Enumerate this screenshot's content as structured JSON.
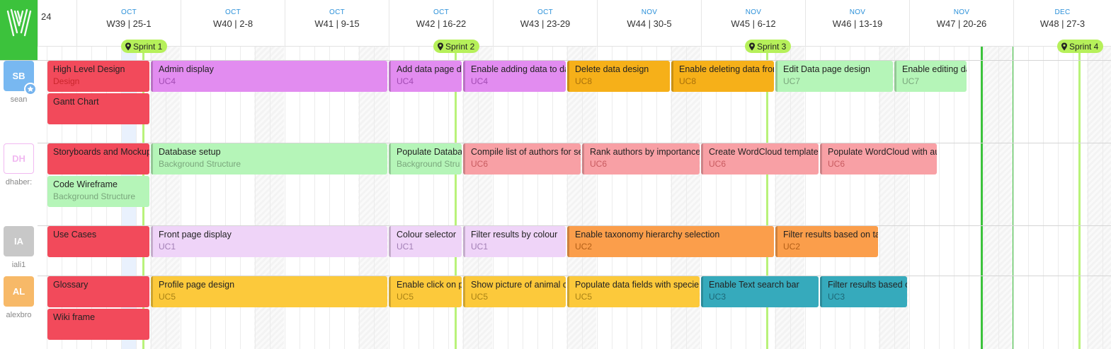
{
  "app": {
    "logo_letter": "W"
  },
  "colors": {
    "red": "#f24a5b",
    "violet": "#e28cf0",
    "green": "#b5f5b8",
    "amber": "#f6b019",
    "pink": "#f8a0a5",
    "lilac": "#efd4f8",
    "orange": "#fb9e4b",
    "yellow": "#fcc93b",
    "teal": "#36aabc",
    "sprint": "#b6f05a"
  },
  "timeline": {
    "first_partial": "24",
    "weeks": [
      {
        "month": "OCT",
        "label": "W39 | 25-1"
      },
      {
        "month": "OCT",
        "label": "W40 | 2-8"
      },
      {
        "month": "OCT",
        "label": "W41 | 9-15"
      },
      {
        "month": "OCT",
        "label": "W42 | 16-22"
      },
      {
        "month": "OCT",
        "label": "W43 | 23-29"
      },
      {
        "month": "NOV",
        "label": "W44 | 30-5"
      },
      {
        "month": "NOV",
        "label": "W45 | 6-12"
      },
      {
        "month": "NOV",
        "label": "W46 | 13-19"
      },
      {
        "month": "NOV",
        "label": "W47 | 20-26"
      },
      {
        "month": "DEC",
        "label": "W48 | 27-3"
      }
    ]
  },
  "sprints": [
    "Sprint 1",
    "Sprint 2",
    "Sprint 3",
    "Sprint 4"
  ],
  "users": [
    {
      "initials": "SB",
      "name": "sean",
      "color": "#78b8f1",
      "admin": true,
      "icon": "star-icon"
    },
    {
      "initials": "DH",
      "name": "dhaber:",
      "color": "#f1b9f1",
      "outline": true
    },
    {
      "initials": "IA",
      "name": "iali1",
      "color": "#c8c8c8"
    },
    {
      "initials": "AL",
      "name": "alexbro",
      "color": "#f7b968"
    }
  ],
  "tasks": [
    {
      "title": "High Level Design",
      "sub": "Design",
      "color": "#f24a5b",
      "sub_color": "#c9262c",
      "text": "#222"
    },
    {
      "title": "Admin display",
      "sub": "UC4",
      "color": "#e28cf0",
      "sub_color": "#a24bb3",
      "text": "#222"
    },
    {
      "title": "Add data page d",
      "sub": "UC4",
      "color": "#e28cf0",
      "sub_color": "#a24bb3",
      "text": "#222"
    },
    {
      "title": "Enable adding data to da",
      "sub": "UC4",
      "color": "#e28cf0",
      "sub_color": "#a24bb3",
      "text": "#222"
    },
    {
      "title": "Delete data design",
      "sub": "UC8",
      "color": "#f6b019",
      "sub_color": "#a8700a",
      "text": "#222"
    },
    {
      "title": "Enable deleting data fron",
      "sub": "UC8",
      "color": "#f6b019",
      "sub_color": "#a8700a",
      "text": "#222"
    },
    {
      "title": "Edit Data page design",
      "sub": "UC7",
      "color": "#b5f5b8",
      "sub_color": "#7aa67c",
      "text": "#222"
    },
    {
      "title": "Enable editing da",
      "sub": "UC7",
      "color": "#b5f5b8",
      "sub_color": "#7aa67c",
      "text": "#222"
    },
    {
      "title": "Gantt Chart",
      "sub": "",
      "color": "#f24a5b",
      "sub_color": "#c9262c",
      "text": "#222"
    },
    {
      "title": "Storyboards and Mockup",
      "sub": "",
      "color": "#f24a5b",
      "sub_color": "#c9262c",
      "text": "#222"
    },
    {
      "title": "Database setup",
      "sub": "Background Structure",
      "color": "#b5f5b8",
      "sub_color": "#7aa67c",
      "text": "#222"
    },
    {
      "title": "Populate Databa",
      "sub": "Background Stru",
      "color": "#b5f5b8",
      "sub_color": "#7aa67c",
      "text": "#222"
    },
    {
      "title": "Compile list of authors for se",
      "sub": "UC6",
      "color": "#f8a0a5",
      "sub_color": "#c85b60",
      "text": "#222"
    },
    {
      "title": "Rank authors by importance",
      "sub": "UC6",
      "color": "#f8a0a5",
      "sub_color": "#c85b60",
      "text": "#222"
    },
    {
      "title": "Create WordCloud template",
      "sub": "UC6",
      "color": "#f8a0a5",
      "sub_color": "#c85b60",
      "text": "#222"
    },
    {
      "title": "Populate WordCloud with au",
      "sub": "UC6",
      "color": "#f8a0a5",
      "sub_color": "#c85b60",
      "text": "#222"
    },
    {
      "title": "Code Wireframe",
      "sub": "Background Structure",
      "color": "#b5f5b8",
      "sub_color": "#7aa67c",
      "text": "#222"
    },
    {
      "title": "Use Cases",
      "sub": "",
      "color": "#f24a5b",
      "sub_color": "#c9262c",
      "text": "#222"
    },
    {
      "title": "Front page display",
      "sub": "UC1",
      "color": "#efd4f8",
      "sub_color": "#a27fb5",
      "text": "#222"
    },
    {
      "title": "Colour selector",
      "sub": "UC1",
      "color": "#efd4f8",
      "sub_color": "#a27fb5",
      "text": "#222"
    },
    {
      "title": "Filter results by colour",
      "sub": "UC1",
      "color": "#efd4f8",
      "sub_color": "#a27fb5",
      "text": "#222"
    },
    {
      "title": "Enable taxonomy hierarchy selection",
      "sub": "UC2",
      "color": "#fb9e4b",
      "sub_color": "#b35f17",
      "text": "#222"
    },
    {
      "title": "Filter results based on ta",
      "sub": "UC2",
      "color": "#fb9e4b",
      "sub_color": "#b35f17",
      "text": "#222"
    },
    {
      "title": "Glossary",
      "sub": "",
      "color": "#f24a5b",
      "sub_color": "#c9262c",
      "text": "#222"
    },
    {
      "title": "Profile page design",
      "sub": "UC5",
      "color": "#fcc93b",
      "sub_color": "#a98215",
      "text": "#222"
    },
    {
      "title": "Enable click on p",
      "sub": "UC5",
      "color": "#fcc93b",
      "sub_color": "#a98215",
      "text": "#222"
    },
    {
      "title": "Show picture of animal c",
      "sub": "UC5",
      "color": "#fcc93b",
      "sub_color": "#a98215",
      "text": "#222"
    },
    {
      "title": "Populate data fields with specie",
      "sub": "UC5",
      "color": "#fcc93b",
      "sub_color": "#a98215",
      "text": "#222"
    },
    {
      "title": "Enable Text search bar",
      "sub": "UC3",
      "color": "#36aabc",
      "sub_color": "#1d6877",
      "text": "#222"
    },
    {
      "title": "Filter results based o",
      "sub": "UC3",
      "color": "#36aabc",
      "sub_color": "#1d6877",
      "text": "#222"
    },
    {
      "title": "Wiki frame",
      "sub": "",
      "color": "#f24a5b",
      "sub_color": "#c9262c",
      "text": "#222"
    }
  ]
}
